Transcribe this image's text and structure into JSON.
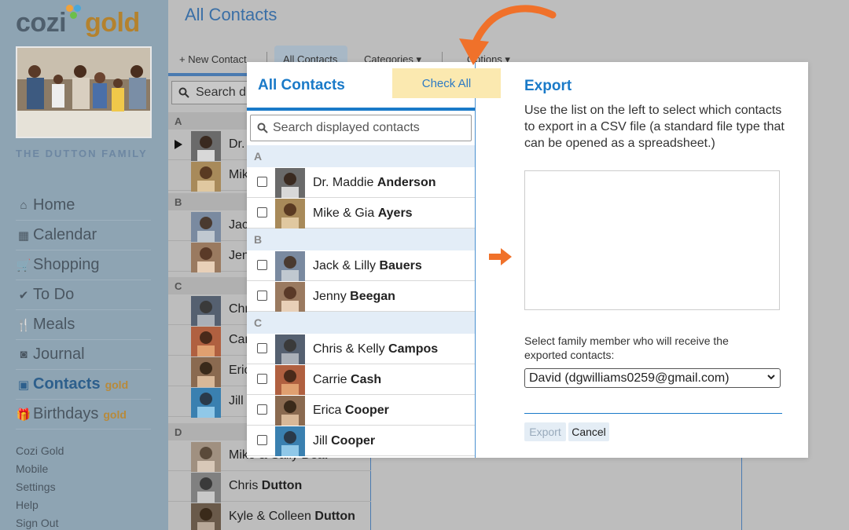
{
  "app": {
    "logo_text_left": "cozi",
    "logo_text_right": "gold",
    "family_name": "THE DUTTON FAMILY"
  },
  "sidebar": {
    "nav": [
      {
        "label": "Home",
        "icon": "home-icon",
        "glyph": "⌂"
      },
      {
        "label": "Calendar",
        "icon": "calendar-icon",
        "glyph": "▦"
      },
      {
        "label": "Shopping",
        "icon": "cart-icon",
        "glyph": "🛒"
      },
      {
        "label": "To Do",
        "icon": "check-icon",
        "glyph": "✔"
      },
      {
        "label": "Meals",
        "icon": "utensils-icon",
        "glyph": "🍴"
      },
      {
        "label": "Journal",
        "icon": "camera-icon",
        "glyph": "◙"
      },
      {
        "label": "Contacts",
        "icon": "address-book-icon",
        "glyph": "▣",
        "badge": "gold",
        "active": true
      },
      {
        "label": "Birthdays",
        "icon": "gift-icon",
        "glyph": "🎁",
        "badge": "gold"
      }
    ],
    "footer": [
      "Cozi Gold",
      "Mobile",
      "Settings",
      "Help",
      "Sign Out"
    ]
  },
  "background": {
    "page_title": "All Contacts",
    "toolbar": {
      "new_contact": "+ New Contact",
      "all_contacts": "All Contacts",
      "categories": "Categories ▾",
      "options": "Options ▾"
    },
    "search_placeholder": "Search di",
    "letters": [
      "A",
      "B",
      "C",
      "D"
    ],
    "rows": [
      {
        "first": "Dr.",
        "last": ""
      },
      {
        "first": "Mik",
        "last": ""
      },
      {
        "first": "Jack",
        "last": ""
      },
      {
        "first": "Jenn",
        "last": ""
      },
      {
        "first": "Chr",
        "last": ""
      },
      {
        "first": "Car",
        "last": ""
      },
      {
        "first": "Eric",
        "last": ""
      },
      {
        "first": "Jill C",
        "last": ""
      },
      {
        "first": "Mike & Sally ",
        "last": "Deal"
      },
      {
        "first": "Chris ",
        "last": "Dutton"
      },
      {
        "first": "Kyle & Colleen ",
        "last": "Dutton"
      }
    ]
  },
  "dialog": {
    "left_title": "All Contacts",
    "check_all": "Check All",
    "search_placeholder": "Search displayed contacts",
    "letters": [
      "A",
      "B",
      "C"
    ],
    "contacts": [
      {
        "first": "Dr. Maddie ",
        "last": "Anderson",
        "checked": false
      },
      {
        "first": "Mike & Gia ",
        "last": "Ayers",
        "checked": false
      },
      {
        "first": "Jack & Lilly ",
        "last": "Bauers",
        "checked": false
      },
      {
        "first": "Jenny ",
        "last": "Beegan",
        "checked": false
      },
      {
        "first": "Chris & Kelly ",
        "last": "Campos",
        "checked": false
      },
      {
        "first": "Carrie ",
        "last": "Cash",
        "checked": false
      },
      {
        "first": "Erica ",
        "last": "Cooper",
        "checked": false
      },
      {
        "first": "Jill ",
        "last": "Cooper",
        "checked": false
      }
    ],
    "export": {
      "title": "Export",
      "description": "Use the list on the left to select which contacts to export in a CSV file (a standard file type that can be opened as a spreadsheet.)",
      "select_label": "Select family member who will receive the exported contacts:",
      "selected_member": "David (dgwilliams0259@gmail.com)",
      "export_button": "Export",
      "cancel_button": "Cancel"
    }
  },
  "colors": {
    "accent_blue": "#1a7ac8",
    "arrow_orange": "#f0712a",
    "check_all_bg": "#fbe9b0",
    "sidebar_bg": "#8ea4b3"
  }
}
